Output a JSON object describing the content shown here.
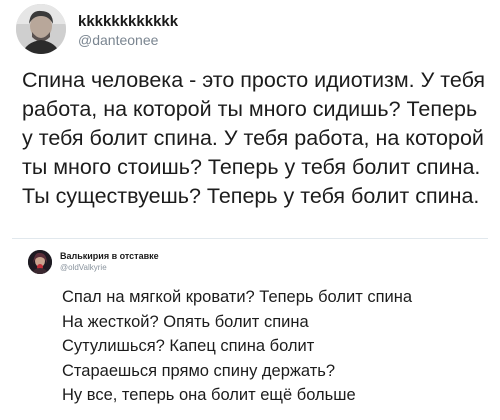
{
  "tweets": [
    {
      "author_name": "kkkkkkkkkkkk",
      "handle": "@danteonee",
      "text": "Спина человека - это просто идиотизм. У тебя работа, на которой ты много сидишь? Теперь у тебя болит спина. У тебя работа, на которой ты много стоишь? Теперь у тебя болит спина.  Ты существуешь? Теперь у тебя болит спина."
    },
    {
      "author_name": "Валькирия в отставке",
      "handle": "@oldValkyrie",
      "lines": [
        "Спал на мягкой кровати? Теперь болит спина",
        "На жесткой? Опять болит спина",
        "Сутулишься? Капец спина болит",
        "Стараешься прямо спину держать?",
        "Ну все, теперь она болит ещё больше"
      ]
    }
  ],
  "colors": {
    "text": "#1c1c1c",
    "handle": "#7a8590",
    "divider": "#e1e8ed"
  }
}
